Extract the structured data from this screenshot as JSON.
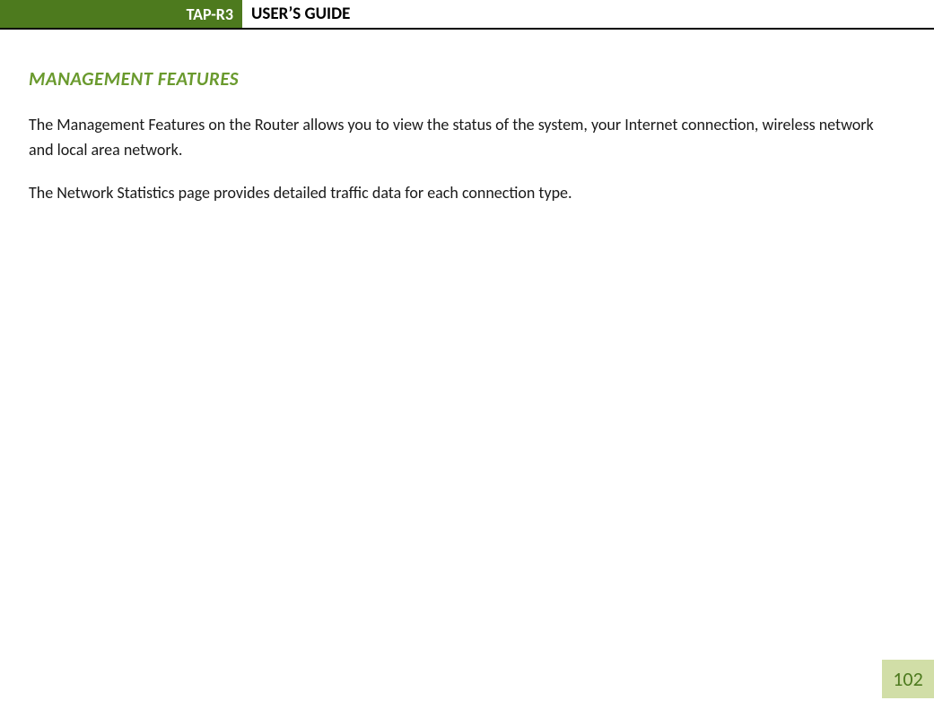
{
  "header": {
    "badge": "TAP-R3",
    "title": "USER’S GUIDE"
  },
  "section": {
    "heading": "MANAGEMENT FEATURES",
    "paragraph1": "The Management Features on the Router allows you to view the status of the system, your Internet connection, wireless network and local area network.",
    "paragraph2": "The Network Statistics page provides detailed traffic data for each connection type."
  },
  "page_number": "102"
}
